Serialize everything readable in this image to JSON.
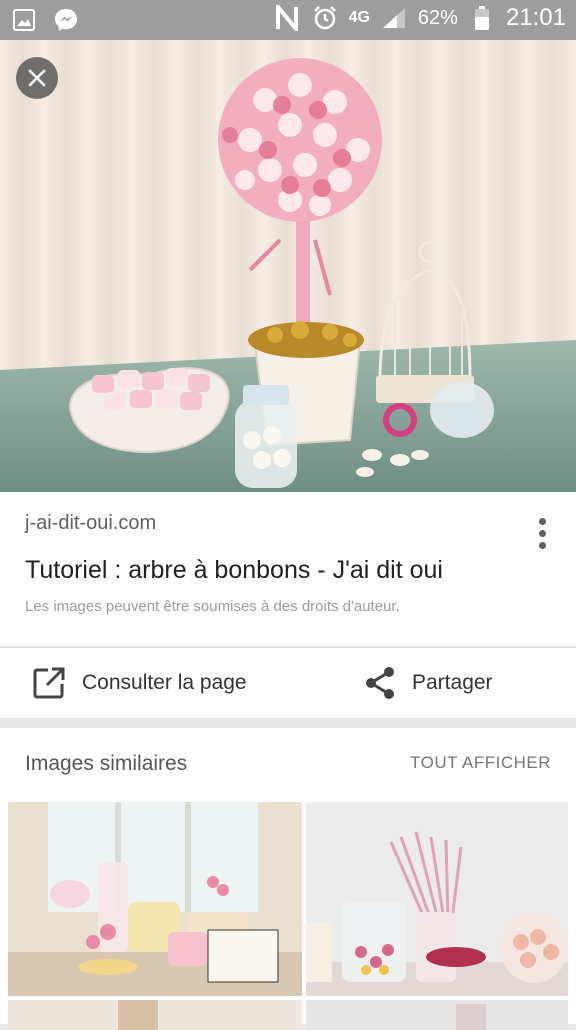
{
  "status_bar": {
    "battery": "62%",
    "network": "4G",
    "time": "21:01"
  },
  "result": {
    "domain": "j-ai-dit-oui.com",
    "title": "Tutoriel : arbre à bonbons - J'ai dit oui",
    "copyright": "Les images peuvent être soumises à des droits d'auteur."
  },
  "actions": {
    "visit_label": "Consulter la page",
    "share_label": "Partager"
  },
  "similar": {
    "heading": "Images similaires",
    "show_all": "TOUT AFFICHER"
  }
}
